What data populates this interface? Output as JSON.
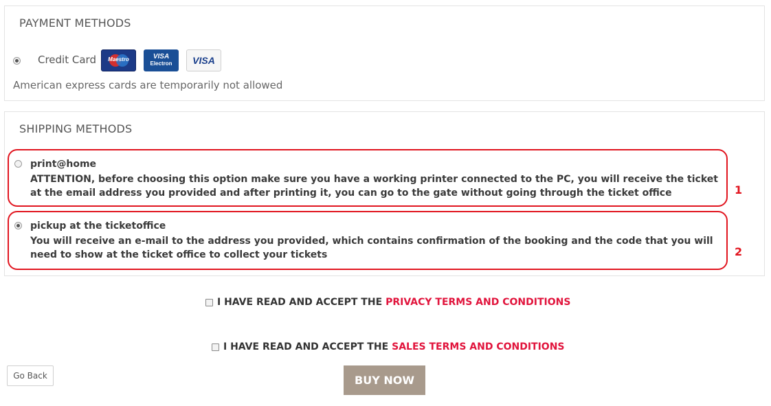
{
  "payment": {
    "title": "PAYMENT METHODS",
    "credit_card_label": "Credit Card",
    "cards": [
      {
        "name": "maestro-card-icon",
        "text": "Maestro"
      },
      {
        "name": "visa-electron-card-icon",
        "line1": "VISA",
        "line2": "Electron"
      },
      {
        "name": "visa-card-icon",
        "text": "VISA"
      }
    ],
    "note": "American express cards are temporarily not allowed"
  },
  "shipping": {
    "title": "SHIPPING METHODS",
    "options": [
      {
        "title": "print@home",
        "description": "ATTENTION, before choosing this option make sure you have a working printer connected to the PC, you will receive the ticket at the email address you provided and after printing it, you can go to the gate without going through the ticket office",
        "selected": false,
        "annotation": "1"
      },
      {
        "title": "pickup at the ticketoffice",
        "description": "You will receive an e-mail to the address you provided, which contains confirmation of the booking and the code that you will need to show at the ticket office to collect your tickets",
        "selected": true,
        "annotation": "2"
      }
    ]
  },
  "terms": {
    "privacy_prefix": "I HAVE READ AND ACCEPT THE",
    "privacy_link": "PRIVACY TERMS AND CONDITIONS",
    "sales_prefix": "I HAVE READ AND ACCEPT THE",
    "sales_link": "SALES TERMS AND CONDITIONS"
  },
  "buttons": {
    "go_back": "Go Back",
    "buy_now": "BUY NOW"
  },
  "colors": {
    "accent_red": "#e1141e",
    "link_red": "#e1143c",
    "buy_button": "#a89a8c"
  }
}
